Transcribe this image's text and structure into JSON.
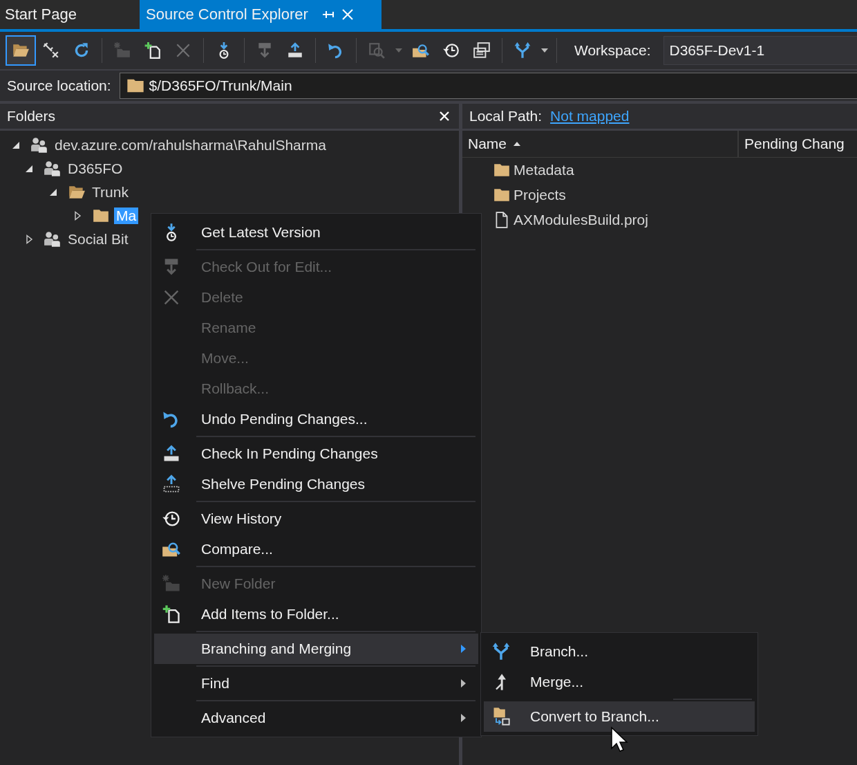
{
  "tabs": [
    {
      "label": "Start Page",
      "selected": false
    },
    {
      "label": "Source Control Explorer",
      "selected": true
    }
  ],
  "toolbar": {
    "items": [
      {
        "kind": "open-folder",
        "selected": true,
        "disabled": false
      },
      {
        "kind": "disconnect",
        "selected": false,
        "disabled": false
      },
      {
        "kind": "refresh",
        "selected": false,
        "disabled": false
      },
      {
        "kind": "separator"
      },
      {
        "kind": "new-folder",
        "selected": false,
        "disabled": true
      },
      {
        "kind": "add-items",
        "selected": false,
        "disabled": false
      },
      {
        "kind": "delete",
        "selected": false,
        "disabled": true
      },
      {
        "kind": "separator"
      },
      {
        "kind": "get-latest",
        "selected": false,
        "disabled": false
      },
      {
        "kind": "separator"
      },
      {
        "kind": "checkout",
        "selected": false,
        "disabled": true
      },
      {
        "kind": "checkin",
        "selected": false,
        "disabled": false
      },
      {
        "kind": "separator"
      },
      {
        "kind": "undo",
        "selected": false,
        "disabled": false
      },
      {
        "kind": "separator"
      },
      {
        "kind": "find",
        "selected": false,
        "disabled": true,
        "dropdown": true
      },
      {
        "kind": "compare",
        "selected": false,
        "disabled": false
      },
      {
        "kind": "history",
        "selected": false,
        "disabled": false
      },
      {
        "kind": "workspaces",
        "selected": false,
        "disabled": false
      },
      {
        "kind": "separator"
      },
      {
        "kind": "branch",
        "selected": false,
        "disabled": false,
        "dropdown": true
      },
      {
        "kind": "separator"
      }
    ],
    "workspace_label": "Workspace:",
    "workspace": "D365F-Dev1-1"
  },
  "source_location": {
    "label": "Source location:",
    "path": "$/D365FO/Trunk/Main"
  },
  "folders_panel": {
    "title": "Folders",
    "tree": [
      {
        "label": "dev.azure.com/rahulsharma\\RahulSharma",
        "kind": "team-project",
        "expanded": true,
        "selected": false,
        "children": [
          {
            "label": "D365FO",
            "kind": "team-project",
            "expanded": true,
            "selected": false,
            "children": [
              {
                "label": "Trunk",
                "kind": "open-folder",
                "expanded": true,
                "selected": false,
                "children": [
                  {
                    "label": "Ma",
                    "kind": "folder",
                    "expanded": false,
                    "selected": true
                  }
                ]
              }
            ]
          },
          {
            "label": "Social Bit",
            "kind": "team-project",
            "expanded": false,
            "selected": false
          }
        ]
      }
    ]
  },
  "details_panel": {
    "local_path_label": "Local Path:",
    "local_path": "Not mapped",
    "columns": [
      {
        "label": "Name",
        "sorted": true
      },
      {
        "label": "Pending Chang",
        "sorted": false
      }
    ],
    "rows": [
      {
        "name": "Metadata",
        "kind": "folder"
      },
      {
        "name": "Projects",
        "kind": "folder"
      },
      {
        "name": "AXModulesBuild.proj",
        "kind": "file"
      }
    ]
  },
  "context_menu": {
    "items": [
      {
        "kind": "get-latest",
        "label": "Get Latest Version",
        "disabled": false,
        "submenu": false,
        "highlighted": false
      },
      {
        "kind": "separator"
      },
      {
        "kind": "checkout",
        "label": "Check Out for Edit...",
        "disabled": true,
        "submenu": false,
        "highlighted": false
      },
      {
        "kind": "delete",
        "label": "Delete",
        "disabled": true,
        "submenu": false,
        "highlighted": false
      },
      {
        "kind": "plain",
        "label": "Rename",
        "disabled": true,
        "submenu": false,
        "highlighted": false
      },
      {
        "kind": "plain",
        "label": "Move...",
        "disabled": true,
        "submenu": false,
        "highlighted": false
      },
      {
        "kind": "plain",
        "label": "Rollback...",
        "disabled": true,
        "submenu": false,
        "highlighted": false
      },
      {
        "kind": "undo",
        "label": "Undo Pending Changes...",
        "disabled": false,
        "submenu": false,
        "highlighted": false
      },
      {
        "kind": "separator"
      },
      {
        "kind": "checkin",
        "label": "Check In Pending Changes",
        "disabled": false,
        "submenu": false,
        "highlighted": false
      },
      {
        "kind": "shelve",
        "label": "Shelve Pending Changes",
        "disabled": false,
        "submenu": false,
        "highlighted": false
      },
      {
        "kind": "separator"
      },
      {
        "kind": "history",
        "label": "View History",
        "disabled": false,
        "submenu": false,
        "highlighted": false
      },
      {
        "kind": "compare",
        "label": "Compare...",
        "disabled": false,
        "submenu": false,
        "highlighted": false
      },
      {
        "kind": "separator"
      },
      {
        "kind": "new-folder",
        "label": "New Folder",
        "disabled": true,
        "submenu": false,
        "highlighted": false
      },
      {
        "kind": "add-items",
        "label": "Add Items to Folder...",
        "disabled": false,
        "submenu": false,
        "highlighted": false
      },
      {
        "kind": "separator"
      },
      {
        "kind": "plain",
        "label": "Branching and Merging",
        "disabled": false,
        "submenu": true,
        "highlighted": true
      },
      {
        "kind": "separator"
      },
      {
        "kind": "plain",
        "label": "Find",
        "disabled": false,
        "submenu": true,
        "highlighted": false
      },
      {
        "kind": "separator"
      },
      {
        "kind": "plain",
        "label": "Advanced",
        "disabled": false,
        "submenu": true,
        "highlighted": false
      }
    ]
  },
  "submenu": {
    "items": [
      {
        "kind": "branch",
        "label": "Branch...",
        "disabled": false,
        "submenu": false,
        "highlighted": false
      },
      {
        "kind": "merge",
        "label": "Merge...",
        "disabled": false,
        "submenu": false,
        "highlighted": false
      },
      {
        "kind": "separator"
      },
      {
        "kind": "convert",
        "label": "Convert to Branch...",
        "disabled": false,
        "submenu": false,
        "highlighted": true
      }
    ]
  }
}
